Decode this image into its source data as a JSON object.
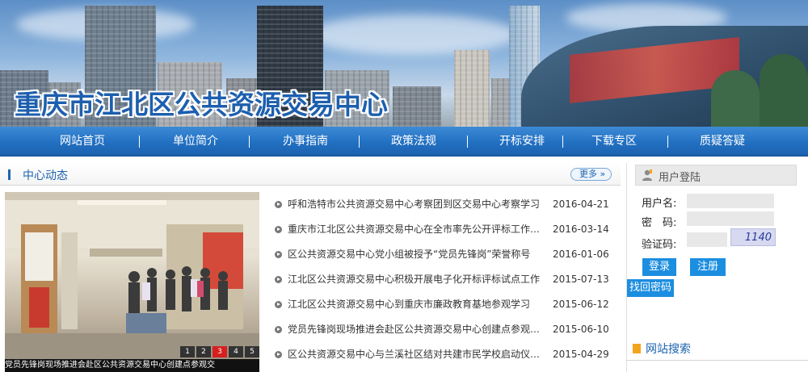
{
  "header": {
    "site_title": "重庆市江北区公共资源交易中心"
  },
  "nav": {
    "items": [
      {
        "label": "网站首页"
      },
      {
        "label": "单位简介"
      },
      {
        "label": "办事指南"
      },
      {
        "label": "政策法规"
      },
      {
        "label": "开标安排"
      },
      {
        "label": "下载专区"
      },
      {
        "label": "质疑答疑"
      }
    ]
  },
  "news_section": {
    "title": "中心动态",
    "more_label": "更多",
    "more_arrow": "»",
    "slideshow": {
      "caption": "党员先锋岗现场推进会赴区公共资源交易中心创建点参观交",
      "pages": [
        "1",
        "2",
        "3",
        "4",
        "5"
      ],
      "active_page": "3"
    },
    "items": [
      {
        "title": "呼和浩特市公共资源交易中心考察团到区交易中心考察学习",
        "date": "2016-04-21"
      },
      {
        "title": "重庆市江北区公共资源交易中心在全市率先公开评标工作现...",
        "date": "2016-03-14"
      },
      {
        "title": "区公共资源交易中心党小组被授予“党员先锋岗”荣誉称号",
        "date": "2016-01-06"
      },
      {
        "title": "江北区公共资源交易中心积极开展电子化开标评标试点工作",
        "date": "2015-07-13"
      },
      {
        "title": "江北区公共资源交易中心到重庆市廉政教育基地参观学习",
        "date": "2015-06-12"
      },
      {
        "title": "党员先锋岗现场推进会赴区公共资源交易中心创建点参观交...",
        "date": "2015-06-10"
      },
      {
        "title": "区公共资源交易中心与兰溪社区结对共建市民学校启动仪式...",
        "date": "2015-04-29"
      }
    ]
  },
  "login": {
    "title": "用户登陆",
    "username_label": "用户名:",
    "password_label": "密　码:",
    "captcha_label": "验证码:",
    "captcha_text": "1140",
    "login_button": "登录",
    "register_button": "注册",
    "forgot_button": "找回密码"
  },
  "search": {
    "title": "网站搜索"
  },
  "colors": {
    "brand_blue": "#1c63b0",
    "nav_blue": "#2270c2",
    "button_blue": "#1c8ee0",
    "active_slide": "#d62020"
  }
}
